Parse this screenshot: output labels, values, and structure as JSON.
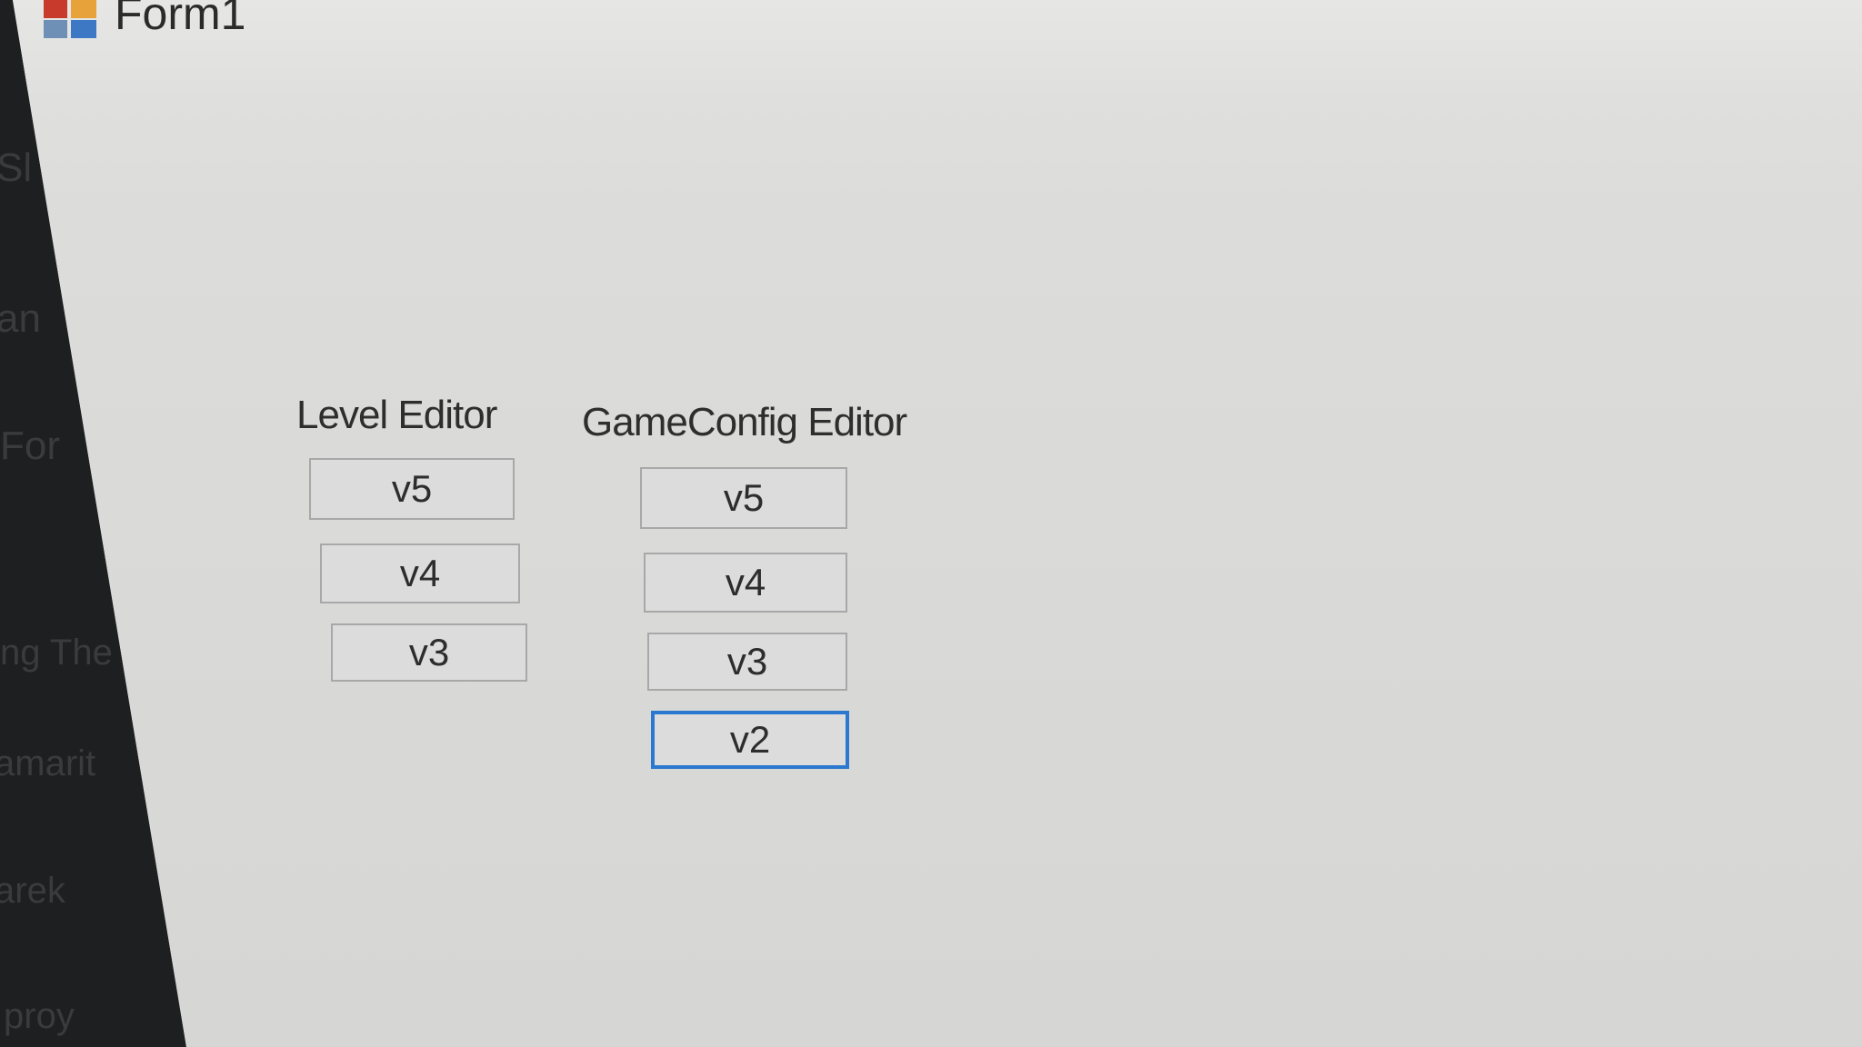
{
  "window": {
    "title": "Form1"
  },
  "background_window": {
    "fragments": [
      "Sl",
      "an",
      "For",
      "ng The",
      "amarit",
      "arek",
      "proy"
    ]
  },
  "level_editor": {
    "label": "Level Editor",
    "buttons": [
      "v5",
      "v4",
      "v3"
    ]
  },
  "gameconfig_editor": {
    "label": "GameConfig Editor",
    "buttons": [
      "v5",
      "v4",
      "v3",
      "v2"
    ],
    "focused_button": "v2"
  },
  "colors": {
    "focus_border": "#2a78d0",
    "button_face": "#dcdcdc",
    "button_border": "#a8a8a8"
  }
}
